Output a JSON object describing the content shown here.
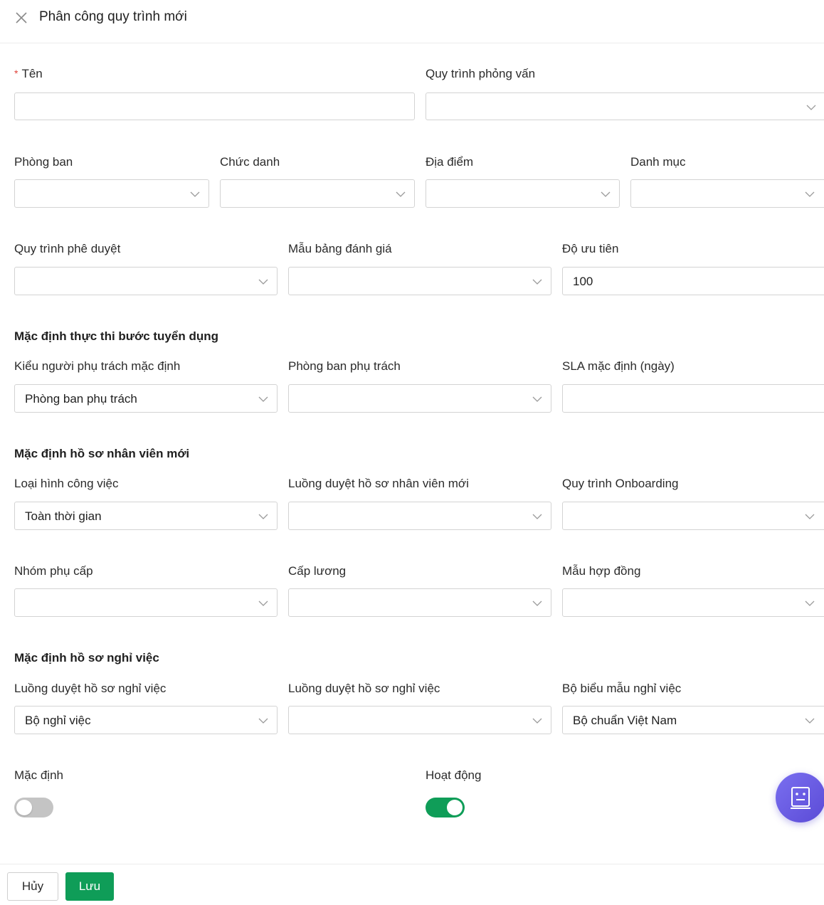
{
  "header": {
    "title": "Phân công quy trình mới"
  },
  "fields": {
    "name": {
      "label": "Tên",
      "required_mark": "*",
      "value": ""
    },
    "interview_process": {
      "label": "Quy trình phỏng vấn",
      "value": ""
    },
    "department": {
      "label": "Phòng ban",
      "value": ""
    },
    "job_title": {
      "label": "Chức danh",
      "value": ""
    },
    "location": {
      "label": "Địa điểm",
      "value": ""
    },
    "category": {
      "label": "Danh mục",
      "value": ""
    },
    "approval_process": {
      "label": "Quy trình phê duyệt",
      "value": ""
    },
    "evaluation_template": {
      "label": "Mẫu bảng đánh giá",
      "value": ""
    },
    "priority": {
      "label": "Độ ưu tiên",
      "value": "100"
    }
  },
  "sections": {
    "recruitment": {
      "title": "Mặc định thực thi bước tuyển dụng",
      "assignee_type": {
        "label": "Kiểu người phụ trách mặc định",
        "value": "Phòng ban phụ trách"
      },
      "assignee_department": {
        "label": "Phòng ban phụ trách",
        "value": ""
      },
      "sla": {
        "label": "SLA mặc định (ngày)",
        "value": ""
      }
    },
    "new_employee": {
      "title": "Mặc định hồ sơ nhân viên mới",
      "job_type": {
        "label": "Loại hình công việc",
        "value": "Toàn thời gian"
      },
      "approval_flow": {
        "label": "Luồng duyệt hồ sơ nhân viên mới",
        "value": ""
      },
      "onboarding": {
        "label": "Quy trình Onboarding",
        "value": ""
      },
      "allowance_group": {
        "label": "Nhóm phụ cấp",
        "value": ""
      },
      "salary_grade": {
        "label": "Cấp lương",
        "value": ""
      },
      "contract_template": {
        "label": "Mẫu hợp đồng",
        "value": ""
      }
    },
    "resignation": {
      "title": "Mặc định hồ sơ nghỉ việc",
      "approval_flow_1": {
        "label": "Luồng duyệt hồ sơ nghỉ việc",
        "value": "Bộ nghỉ việc"
      },
      "approval_flow_2": {
        "label": "Luồng duyệt hồ sơ nghỉ việc",
        "value": ""
      },
      "form_set": {
        "label": "Bộ biểu mẫu nghỉ việc",
        "value": "Bộ chuẩn Việt Nam"
      }
    }
  },
  "toggles": {
    "default": {
      "label": "Mặc định",
      "on": false
    },
    "active": {
      "label": "Hoạt động",
      "on": true
    }
  },
  "footer": {
    "cancel_label": "Hủy",
    "save_label": "Lưu"
  },
  "colors": {
    "accent": "#0f9d58",
    "required": "#e0433a",
    "fab": "#6a5ee6"
  }
}
